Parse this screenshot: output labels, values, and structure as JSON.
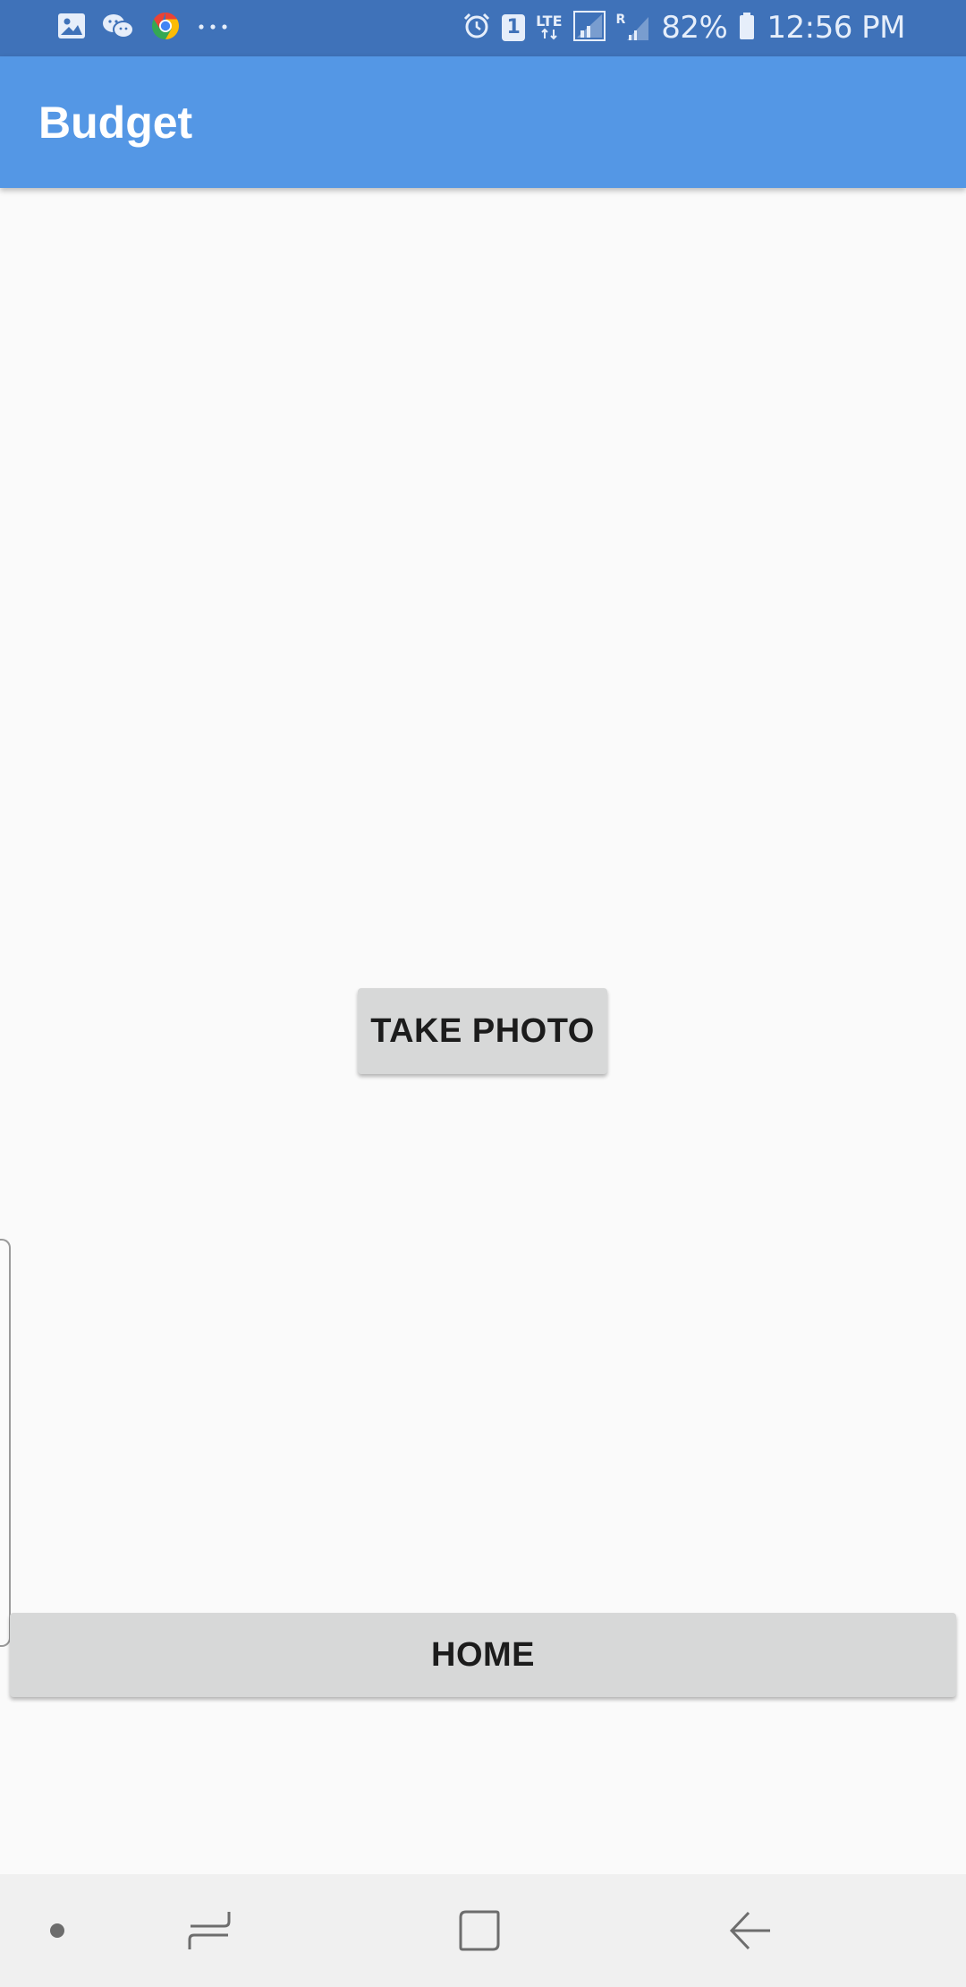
{
  "status_bar": {
    "left_icons": [
      "gallery-icon",
      "wechat-icon",
      "chrome-icon",
      "more-dots-icon"
    ],
    "alarm_icon": "alarm-icon",
    "sim_badge": "1",
    "network": "LTE",
    "roaming": "R",
    "battery_percent": "82%",
    "time": "12:56 PM",
    "color": "#3f72b9"
  },
  "app_bar": {
    "title": "Budget",
    "color": "#5497e5"
  },
  "main": {
    "take_photo_label": "TAKE PHOTO",
    "home_label": "HOME"
  },
  "nav_bar": {
    "items": [
      "dot-icon",
      "recent-apps-icon",
      "home-square-icon",
      "back-arrow-icon"
    ]
  }
}
